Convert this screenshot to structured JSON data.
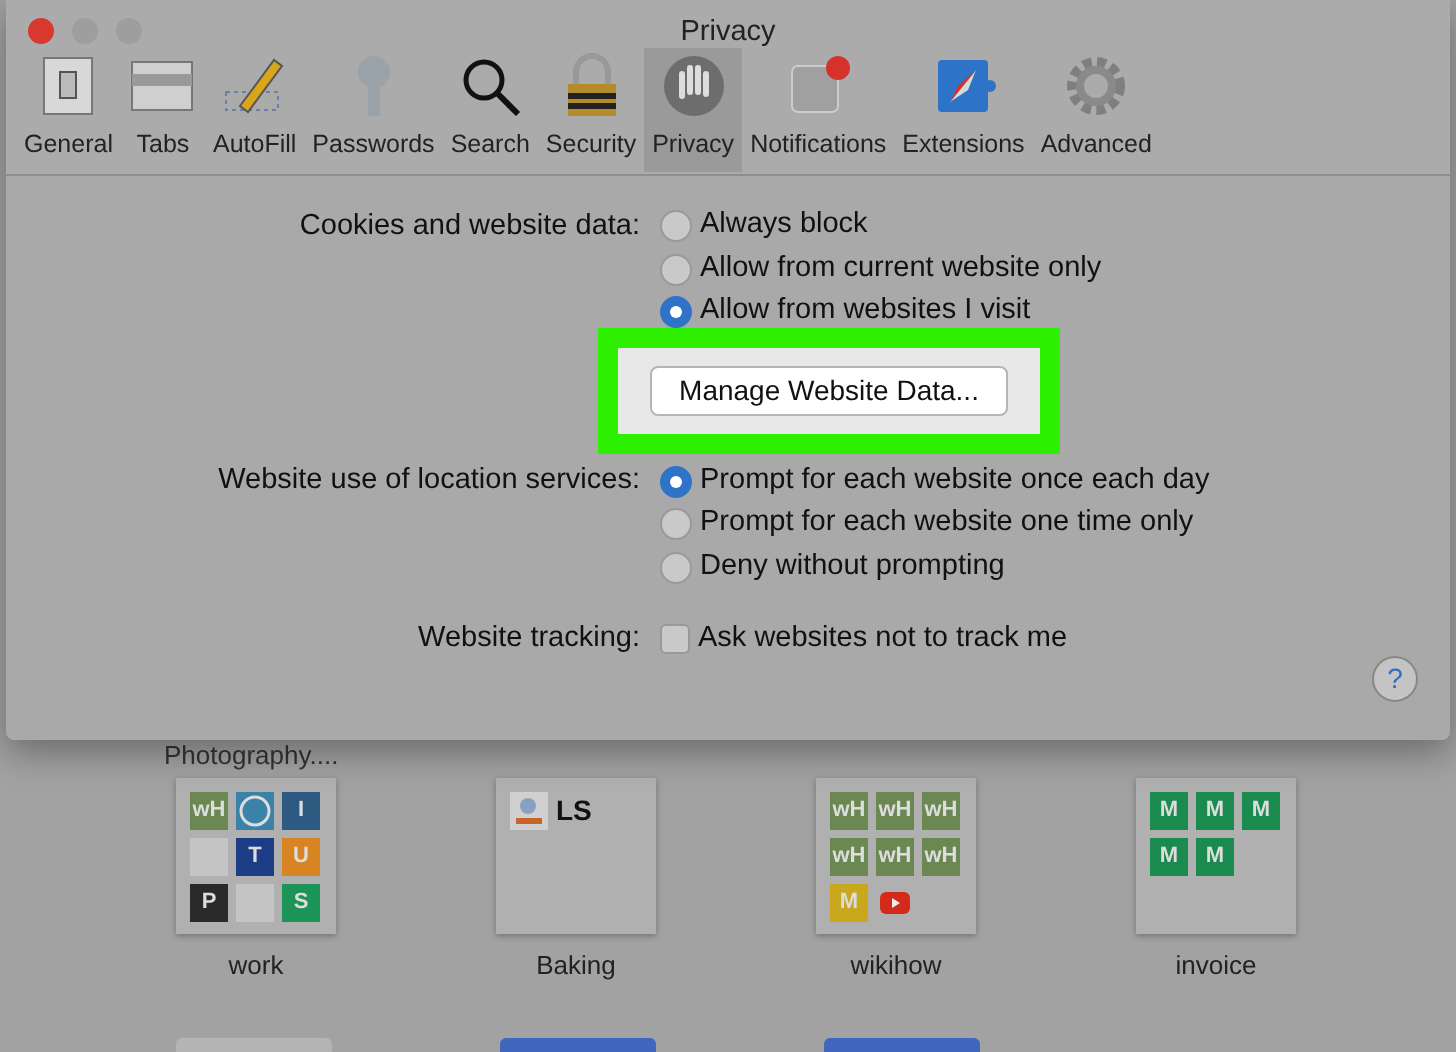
{
  "window": {
    "title": "Privacy"
  },
  "toolbar": [
    {
      "label": "General",
      "selected": false
    },
    {
      "label": "Tabs",
      "selected": false
    },
    {
      "label": "AutoFill",
      "selected": false
    },
    {
      "label": "Passwords",
      "selected": false
    },
    {
      "label": "Search",
      "selected": false
    },
    {
      "label": "Security",
      "selected": false
    },
    {
      "label": "Privacy",
      "selected": true
    },
    {
      "label": "Notifications",
      "selected": false
    },
    {
      "label": "Extensions",
      "selected": false
    },
    {
      "label": "Advanced",
      "selected": false
    }
  ],
  "cookies": {
    "label": "Cookies and website data:",
    "options": [
      {
        "label": "Always block",
        "selected": false
      },
      {
        "label": "Allow from current website only",
        "selected": false
      },
      {
        "label": "Allow from websites I visit",
        "selected": true
      }
    ],
    "highlighted": true,
    "button": "Manage Website Data..."
  },
  "location": {
    "label": "Website use of location services:",
    "options": [
      {
        "label": "Prompt for each website once each day",
        "selected": true
      },
      {
        "label": "Prompt for each website one time only",
        "selected": false
      },
      {
        "label": "Deny without prompting",
        "selected": false
      }
    ]
  },
  "tracking": {
    "label": "Website tracking:",
    "option": {
      "label": "Ask websites not to track me",
      "checked": false
    }
  },
  "help": "?",
  "top_sites": {
    "section_title": "Photography....",
    "tiles": [
      {
        "label": "work",
        "icons": [
          {
            "kind": "text",
            "text": "wH",
            "color": "#6b8752"
          },
          {
            "kind": "wordpress",
            "color": "#3a82a8"
          },
          {
            "kind": "text",
            "text": "I",
            "color": "#2d5a80"
          },
          {
            "kind": "blank",
            "color": "#c4c4c4"
          },
          {
            "kind": "text",
            "text": "T",
            "color": "#1c3c85"
          },
          {
            "kind": "text",
            "text": "U",
            "color": "#d88422"
          },
          {
            "kind": "text",
            "text": "P",
            "color": "#2a2a2a"
          },
          {
            "kind": "blank",
            "color": "#c4c4c4"
          },
          {
            "kind": "text",
            "text": "S",
            "color": "#1d9457"
          }
        ]
      },
      {
        "label": "Baking",
        "icons": [
          {
            "kind": "picture",
            "color": "#d0d0d0"
          },
          {
            "kind": "plain",
            "text": "LS"
          }
        ]
      },
      {
        "label": "wikihow",
        "icons": [
          {
            "kind": "text",
            "text": "wH",
            "color": "#6b8752"
          },
          {
            "kind": "text",
            "text": "wH",
            "color": "#6b8752"
          },
          {
            "kind": "text",
            "text": "wH",
            "color": "#6b8752"
          },
          {
            "kind": "text",
            "text": "wH",
            "color": "#6b8752"
          },
          {
            "kind": "text",
            "text": "wH",
            "color": "#6b8752"
          },
          {
            "kind": "text",
            "text": "wH",
            "color": "#6b8752"
          },
          {
            "kind": "text",
            "text": "M",
            "color": "#c9a81e"
          },
          {
            "kind": "youtube",
            "color": "#d42a1a"
          }
        ]
      },
      {
        "label": "invoice",
        "icons": [
          {
            "kind": "text",
            "text": "M",
            "color": "#1a8a4e"
          },
          {
            "kind": "text",
            "text": "M",
            "color": "#1a8a4e"
          },
          {
            "kind": "text",
            "text": "M",
            "color": "#1a8a4e"
          },
          {
            "kind": "text",
            "text": "M",
            "color": "#1a8a4e"
          },
          {
            "kind": "text",
            "text": "M",
            "color": "#1a8a4e"
          }
        ]
      }
    ]
  }
}
